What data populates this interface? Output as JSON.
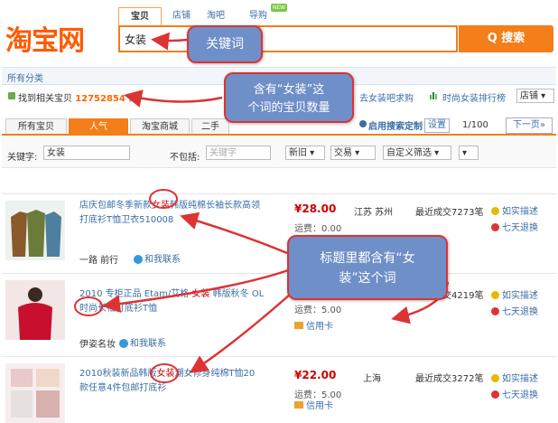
{
  "header": {
    "logo": "淘宝网",
    "tabs": [
      "宝贝",
      "店铺",
      "淘吧",
      "导购"
    ],
    "new_badge": "NEW",
    "search_value": "女装",
    "search_button": "Q 搜索"
  },
  "category": {
    "label": "所有分类"
  },
  "count_row": {
    "prefix": "找到相关宝贝",
    "count": "12752854",
    "suffix": "件",
    "taoba_link": "去女装吧求购",
    "rank_link": "时尚女装排行榜",
    "store_select": "店铺 ▾"
  },
  "result_tabs": {
    "all": "所有宝贝",
    "popular": "人气",
    "mall": "淘宝商城",
    "used": "二手",
    "custom_link": "启用搜索定制",
    "settings": "设置",
    "pager": "1/100",
    "next": "下一页»"
  },
  "filter": {
    "keyword_label": "关键字:",
    "keyword_value": "女装",
    "exclude_label": "不包括:",
    "exclude_placeholder": "关键字",
    "sel_new": "新旧 ▾",
    "sel_trade": "交易 ▾",
    "sel_custom": "自定义筛选 ▾",
    "sel_last": "▾"
  },
  "items": [
    {
      "title_pre": "店庆包邮冬季新款",
      "title_hl": "女装",
      "title_post": "韩版纯棉长袖长款高领打底衫T恤卫衣510008",
      "price": "¥28.00",
      "shipping": "运费：0.00",
      "location": "江苏 苏州",
      "sold": "最近成交7273笔",
      "svc1": "如实描述",
      "svc2": "七天退换",
      "seller": "一路 前行",
      "ww": "和我联系"
    },
    {
      "title_pre": "2010 专柜正品 Etam/艾格 ",
      "title_hl": "女装",
      "title_post": " 韩版秋冬 OL时尚长袖打底衫T恤",
      "price": "¥",
      "shipping": "运费：5.00",
      "location": "",
      "sold": "最近成交4219笔",
      "svc1": "如实描述",
      "svc2": "七天退换",
      "badge": "信用卡",
      "seller": "伊姿名妆",
      "ww": "和我联系"
    },
    {
      "title_pre": "2010秋装新品韩版",
      "title_hl": "女装",
      "title_post": "潮女修身纯棉T恤20款任意4件包邮打底衫",
      "price": "¥22.00",
      "shipping": "运费：5.00",
      "location": "上海",
      "sold": "最近成交3272笔",
      "svc1": "如实描述",
      "svc2": "七天退换",
      "badge": "信用卡"
    }
  ],
  "callouts": {
    "keyword": "关键词",
    "count_line1": "含有“女装”这",
    "count_line2": "个词的宝贝数量",
    "title_line1": "标题里都含有“女",
    "title_line2": "装”这个词"
  },
  "colors": {
    "brand_orange": "#f37e1a",
    "link_blue": "#3a6ea5",
    "price_red": "#cc0000",
    "callout_fill": "#6f8fc8",
    "annotation_red": "#dd3333"
  }
}
